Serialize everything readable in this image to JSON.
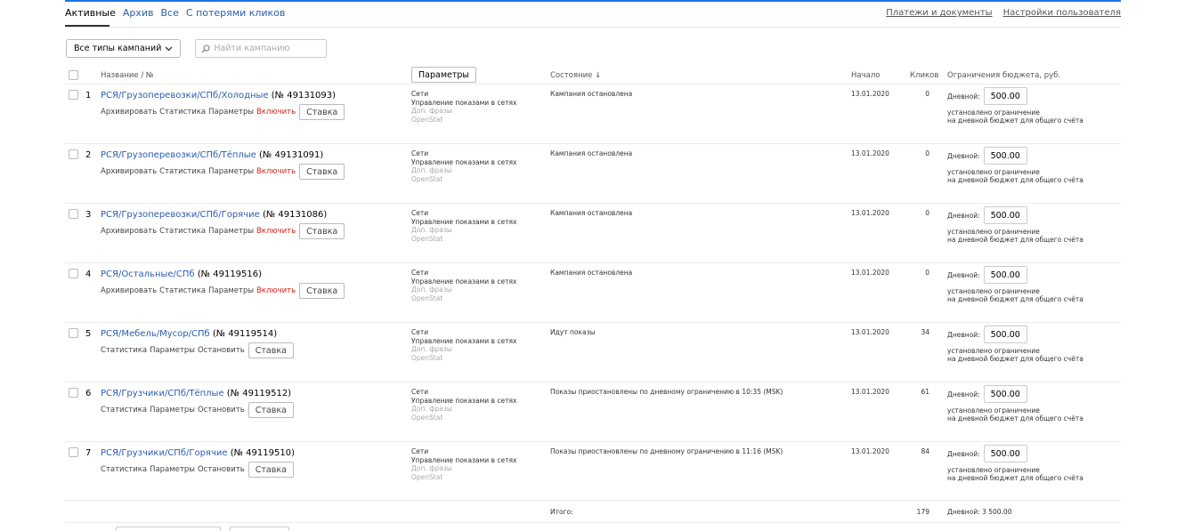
{
  "tabs": [
    {
      "label": "Активные",
      "active": true
    },
    {
      "label": "Архив",
      "active": false
    },
    {
      "label": "Все",
      "active": false
    },
    {
      "label": "С потерями кликов",
      "active": false
    }
  ],
  "top_links": {
    "payments": "Платежи и документы",
    "user_settings": "Настройки пользователя"
  },
  "filters": {
    "campaign_types": "Все типы кампаний",
    "search_placeholder": "Найти кампанию"
  },
  "table_header": {
    "name": "Название / №",
    "params_button": "Параметры",
    "state": "Состояние ↓",
    "start": "Начало",
    "clicks": "Кликов",
    "budget": "Ограничения бюджета, руб."
  },
  "campaigns": [
    {
      "num": "1",
      "name": "РСЯ/Грузоперевозки/СПб/Холодные",
      "id": "(№ 49131093)",
      "actions": [
        "Архивировать",
        "Статистика",
        "Параметры"
      ],
      "toggle": "Включить",
      "toggle_red": true,
      "rate": "Ставка",
      "net": "Сети",
      "net_mgmt": "Управление показами в сетях",
      "extra1": "Доп. фразы",
      "extra2": "OpenStat",
      "state": "Кампания остановлена",
      "start": "13.01.2020",
      "clicks": "0",
      "budget_label": "Дневной:",
      "budget_value": "500.00",
      "budget_note1": "установлено ограничение",
      "budget_note2": "на дневной бюджет для общего счёта"
    },
    {
      "num": "2",
      "name": "РСЯ/Грузоперевозки/СПб/Тёплые",
      "id": "(№ 49131091)",
      "actions": [
        "Архивировать",
        "Статистика",
        "Параметры"
      ],
      "toggle": "Включить",
      "toggle_red": true,
      "rate": "Ставка",
      "net": "Сети",
      "net_mgmt": "Управление показами в сетях",
      "extra1": "Доп. фразы",
      "extra2": "OpenStat",
      "state": "Кампания остановлена",
      "start": "13.01.2020",
      "clicks": "0",
      "budget_label": "Дневной:",
      "budget_value": "500.00",
      "budget_note1": "установлено ограничение",
      "budget_note2": "на дневной бюджет для общего счёта"
    },
    {
      "num": "3",
      "name": "РСЯ/Грузоперевозки/СПб/Горячие",
      "id": "(№ 49131086)",
      "actions": [
        "Архивировать",
        "Статистика",
        "Параметры"
      ],
      "toggle": "Включить",
      "toggle_red": true,
      "rate": "Ставка",
      "net": "Сети",
      "net_mgmt": "Управление показами в сетях",
      "extra1": "Доп. фразы",
      "extra2": "OpenStat",
      "state": "Кампания остановлена",
      "start": "13.01.2020",
      "clicks": "0",
      "budget_label": "Дневной:",
      "budget_value": "500.00",
      "budget_note1": "установлено ограничение",
      "budget_note2": "на дневной бюджет для общего счёта"
    },
    {
      "num": "4",
      "name": "РСЯ/Остальные/СПб",
      "id": "(№ 49119516)",
      "actions": [
        "Архивировать",
        "Статистика",
        "Параметры"
      ],
      "toggle": "Включить",
      "toggle_red": true,
      "rate": "Ставка",
      "net": "Сети",
      "net_mgmt": "Управление показами в сетях",
      "extra1": "Доп. фразы",
      "extra2": "OpenStat",
      "state": "Кампания остановлена",
      "start": "13.01.2020",
      "clicks": "0",
      "budget_label": "Дневной:",
      "budget_value": "500.00",
      "budget_note1": "установлено ограничение",
      "budget_note2": "на дневной бюджет для общего счёта"
    },
    {
      "num": "5",
      "name": "РСЯ/Мебель/Мусор/СПб",
      "id": "(№ 49119514)",
      "actions": [
        "Статистика",
        "Параметры"
      ],
      "toggle": "Остановить",
      "toggle_red": false,
      "rate": "Ставка",
      "net": "Сети",
      "net_mgmt": "Управление показами в сетях",
      "extra1": "Доп. фразы",
      "extra2": "OpenStat",
      "state": "Идут показы",
      "start": "13.01.2020",
      "clicks": "34",
      "budget_label": "Дневной:",
      "budget_value": "500.00",
      "budget_note1": "установлено ограничение",
      "budget_note2": "на дневной бюджет для общего счёта"
    },
    {
      "num": "6",
      "name": "РСЯ/Грузчики/СПб/Тёплые",
      "id": "(№ 49119512)",
      "actions": [
        "Статистика",
        "Параметры"
      ],
      "toggle": "Остановить",
      "toggle_red": false,
      "rate": "Ставка",
      "net": "Сети",
      "net_mgmt": "Управление показами в сетях",
      "extra1": "Доп. фразы",
      "extra2": "OpenStat",
      "state": "Показы приостановлены по дневному ограничению в 10:35 (MSK)",
      "start": "13.01.2020",
      "clicks": "61",
      "budget_label": "Дневной:",
      "budget_value": "500.00",
      "budget_note1": "установлено ограничение",
      "budget_note2": "на дневной бюджет для общего счёта"
    },
    {
      "num": "7",
      "name": "РСЯ/Грузчики/СПб/Горячие",
      "id": "(№ 49119510)",
      "actions": [
        "Статистика",
        "Параметры"
      ],
      "toggle": "Остановить",
      "toggle_red": false,
      "rate": "Ставка",
      "net": "Сети",
      "net_mgmt": "Управление показами в сетях",
      "extra1": "Доп. фразы",
      "extra2": "OpenStat",
      "state": "Показы приостановлены по дневному ограничению в 11:16 (MSK)",
      "start": "13.01.2020",
      "clicks": "84",
      "budget_label": "Дневной:",
      "budget_value": "500.00",
      "budget_note1": "установлено ограничение",
      "budget_note2": "на дневной бюджет для общего счёта"
    }
  ],
  "totals": {
    "label": "Итого:",
    "clicks": "179",
    "budget": "Дневной: 3 500.00"
  },
  "colors": {
    "link": "#2a5db0",
    "danger": "#d8221a",
    "accent_bar": "#1a73e8"
  }
}
